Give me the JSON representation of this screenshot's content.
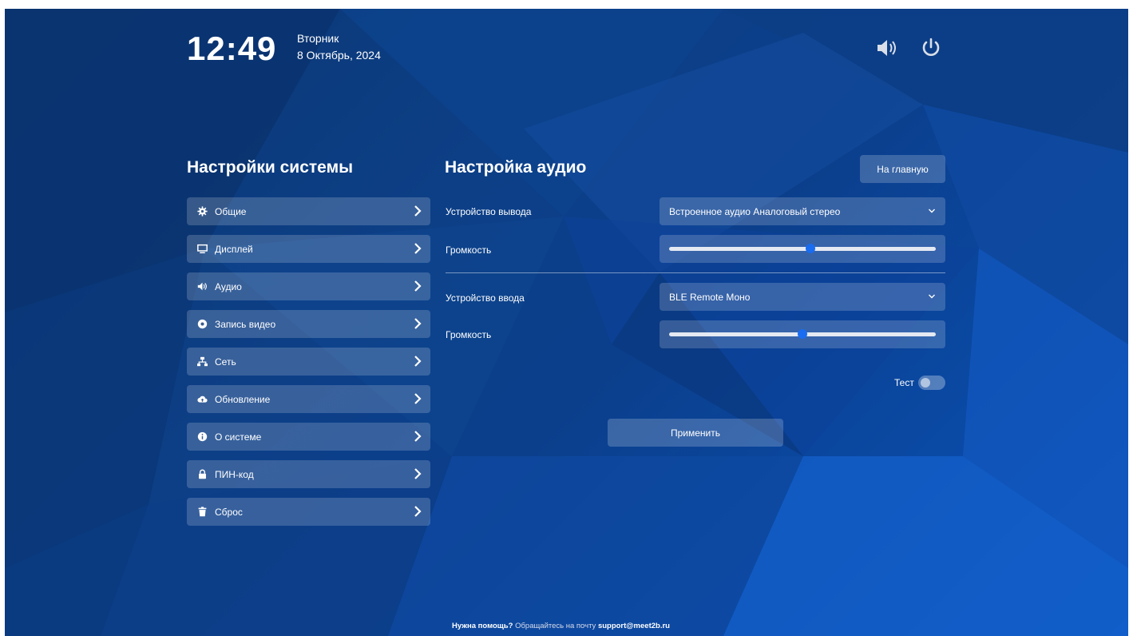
{
  "header": {
    "time": "12:49",
    "weekday": "Вторник",
    "date": "8 Октябрь, 2024",
    "volume_icon": "volume-icon",
    "power_icon": "power-icon"
  },
  "sidebar": {
    "title": "Настройки системы",
    "items": [
      {
        "label": "Общие",
        "icon": "gear-icon"
      },
      {
        "label": "Дисплей",
        "icon": "monitor-icon"
      },
      {
        "label": "Аудио",
        "icon": "speaker-icon"
      },
      {
        "label": "Запись видео",
        "icon": "record-icon"
      },
      {
        "label": "Сеть",
        "icon": "network-icon"
      },
      {
        "label": "Обновление",
        "icon": "cloud-upload-icon"
      },
      {
        "label": "О системе",
        "icon": "info-icon"
      },
      {
        "label": "ПИН-код",
        "icon": "lock-icon"
      },
      {
        "label": "Сброс",
        "icon": "trash-icon"
      }
    ]
  },
  "audio": {
    "title": "Настройка аудио",
    "home_button": "На главную",
    "output_label": "Устройство вывода",
    "output_device": "Встроенное аудио Аналоговый стерео",
    "output_volume_label": "Громкость",
    "output_volume": 0.53,
    "input_label": "Устройство ввода",
    "input_device": "BLE Remote Моно",
    "input_volume_label": "Громкость",
    "input_volume": 0.5,
    "test_label": "Тест",
    "test_enabled": false,
    "apply_button": "Применить"
  },
  "footer": {
    "help_bold": "Нужна помощь?",
    "help_text": " Обращайтесь на почту ",
    "email": "support@meet2b.ru"
  },
  "colors": {
    "accent": "#1a6cf0",
    "background": "#0b3f8c"
  }
}
